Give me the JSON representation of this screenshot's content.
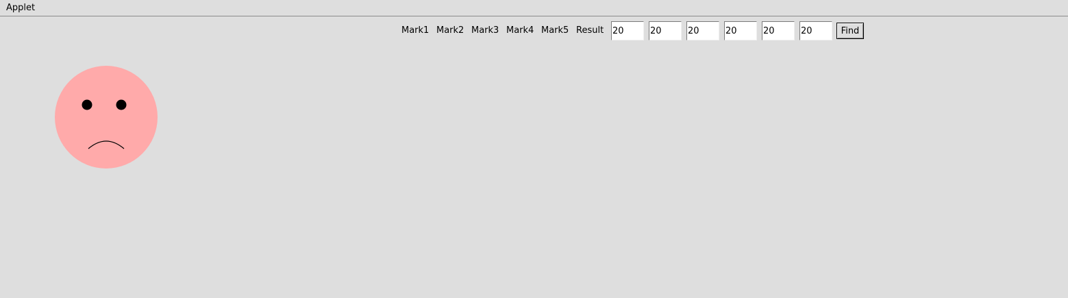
{
  "menu": {
    "applet_label": "Applet"
  },
  "labels": {
    "mark1": "Mark1",
    "mark2": "Mark2",
    "mark3": "Mark3",
    "mark4": "Mark4",
    "mark5": "Mark5",
    "result": "Result"
  },
  "fields": {
    "mark1": "20",
    "mark2": "20",
    "mark3": "20",
    "mark4": "20",
    "mark5": "20",
    "result": "20"
  },
  "buttons": {
    "find": "Find"
  },
  "face": {
    "expression": "sad",
    "face_color": "#ffaaaa",
    "feature_color": "#000000"
  },
  "colors": {
    "background": "#dedede"
  }
}
